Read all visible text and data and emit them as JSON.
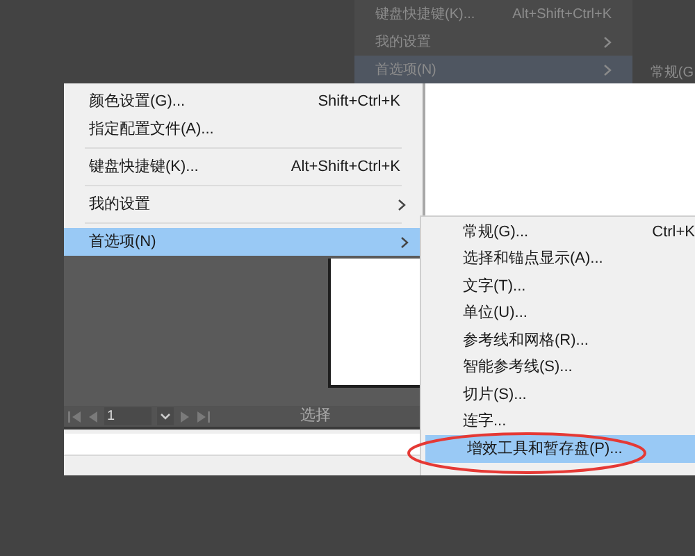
{
  "background_menu": {
    "items": [
      {
        "label": "键盘快捷键(K)...",
        "shortcut": "Alt+Shift+Ctrl+K",
        "submenu": false,
        "selected": false
      },
      {
        "label": "我的设置",
        "submenu": true,
        "selected": false
      },
      {
        "label": "首选项(N)",
        "submenu": true,
        "selected": true
      }
    ],
    "submenu_peek": "常规(G"
  },
  "edit_menu": {
    "items": [
      {
        "kind": "item",
        "label": "颜色设置(G)...",
        "shortcut": "Shift+Ctrl+K",
        "submenu": false,
        "selected": false
      },
      {
        "kind": "item",
        "label": "指定配置文件(A)...",
        "submenu": false,
        "selected": false
      },
      {
        "kind": "separator"
      },
      {
        "kind": "item",
        "label": "键盘快捷键(K)...",
        "shortcut": "Alt+Shift+Ctrl+K",
        "submenu": false,
        "selected": false
      },
      {
        "kind": "separator"
      },
      {
        "kind": "item",
        "label": "我的设置",
        "submenu": true,
        "selected": false
      },
      {
        "kind": "separator"
      },
      {
        "kind": "item",
        "label": "首选项(N)",
        "submenu": true,
        "selected": true
      }
    ]
  },
  "status_bar": {
    "page": "1",
    "tool": "选择"
  },
  "preferences_submenu": {
    "items": [
      {
        "label": "常规(G)...",
        "shortcut": "Ctrl+K",
        "selected": false
      },
      {
        "label": "选择和锚点显示(A)...",
        "selected": false
      },
      {
        "label": "文字(T)...",
        "selected": false
      },
      {
        "label": "单位(U)...",
        "selected": false
      },
      {
        "label": "参考线和网格(R)...",
        "selected": false
      },
      {
        "label": "智能参考线(S)...",
        "selected": false
      },
      {
        "label": "切片(S)...",
        "selected": false
      },
      {
        "label": "连字...",
        "selected": false
      },
      {
        "label": "增效工具和暂存盘(P)...",
        "selected": true,
        "highlighted": true
      }
    ]
  }
}
